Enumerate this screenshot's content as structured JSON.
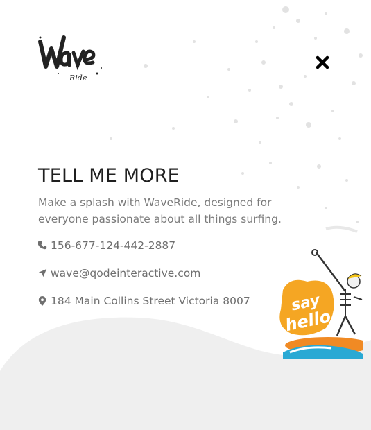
{
  "logo": {
    "word": "Wave",
    "sub": "Ride"
  },
  "close": {
    "icon": "close-icon"
  },
  "info": {
    "heading": "TELL ME MORE",
    "description": "Make a splash with WaveRide, designed for everyone passionate about all things surfing.",
    "phone": "156-677-124-442-2887",
    "email": "wave@qodeinteractive.com",
    "address": "184 Main Collins Street Victoria 8007"
  },
  "sticker": {
    "text_line1": "say",
    "text_line2": "hello"
  },
  "colors": {
    "heading": "#1f1f1f",
    "text": "#7a7a7a",
    "wave_fill": "#efefef",
    "sticker_orange": "#f5a623"
  }
}
